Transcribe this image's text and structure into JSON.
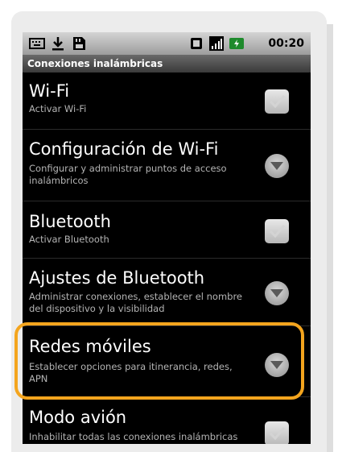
{
  "status_bar": {
    "time": "00:20",
    "icons_left": [
      "keyboard-icon",
      "download-icon",
      "sd-card-icon"
    ],
    "icons_right": [
      "vibrate-icon",
      "signal-icon",
      "battery-icon"
    ]
  },
  "section_header": "Conexiones inalámbricas",
  "items": [
    {
      "title": "Wi-Fi",
      "subtitle": "Activar Wi-Fi",
      "control": "checkbox"
    },
    {
      "title": "Configuración de Wi-Fi",
      "subtitle": "Configurar y administrar puntos de acceso inalámbricos",
      "control": "arrow"
    },
    {
      "title": "Bluetooth",
      "subtitle": "Activar Bluetooth",
      "control": "checkbox"
    },
    {
      "title": "Ajustes de Bluetooth",
      "subtitle": "Administrar conexiones, establecer el nombre del dispositivo y la visibilidad",
      "control": "arrow"
    },
    {
      "title": "Redes móviles",
      "subtitle": "Establecer opciones para itinerancia, redes, APN",
      "control": "arrow",
      "highlighted": true
    },
    {
      "title": "Modo avión",
      "subtitle": "Inhabilitar todas las conexiones inalámbricas",
      "control": "checkbox"
    }
  ],
  "colors": {
    "highlight": "#f4a51e",
    "background": "#000000",
    "subtitle": "#b4b4b4"
  }
}
